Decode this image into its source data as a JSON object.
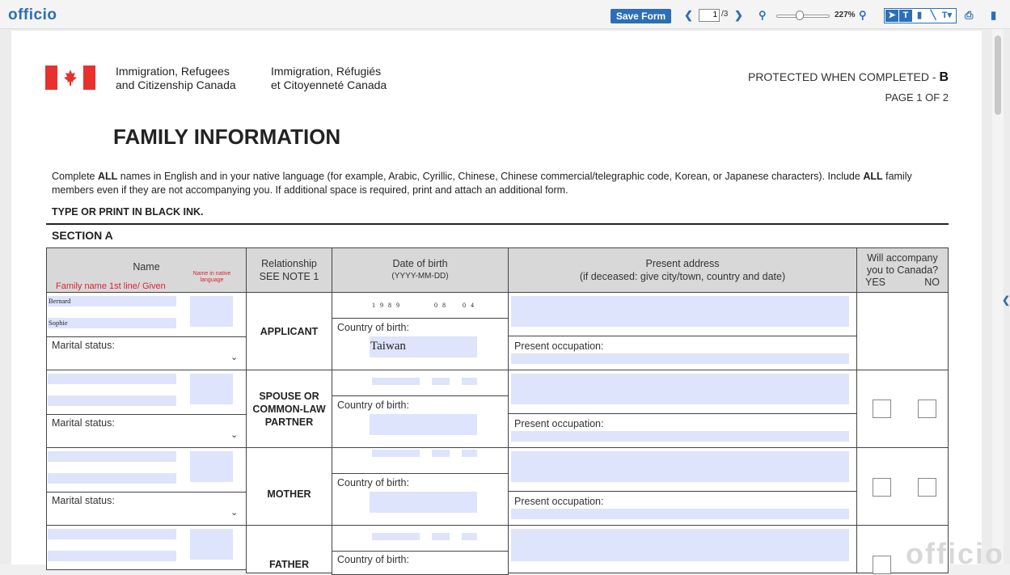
{
  "toolbar": {
    "logo": "officio",
    "save_label": "Save Form",
    "page_current": "1",
    "page_total": "/3",
    "zoom_level": "227%"
  },
  "header": {
    "dept_en_line1": "Immigration, Refugees",
    "dept_en_line2": "and Citizenship Canada",
    "dept_fr_line1": "Immigration, Réfugiés",
    "dept_fr_line2": "et Citoyenneté Canada",
    "protected_label": "PROTECTED WHEN COMPLETED - ",
    "protected_grade": "B",
    "page_count": "PAGE 1 OF 2"
  },
  "form": {
    "title": "FAMILY INFORMATION",
    "intro_part1": "Complete ",
    "intro_bold1": "ALL",
    "intro_part2": " names in English and in your native language (for example, Arabic, Cyrillic, Chinese, Chinese commercial/telegraphic code, Korean, or Japanese characters). Include ",
    "intro_bold2": "ALL",
    "intro_part3": " family members even if they are not accompanying you. If additional space is required, print and attach an additional form.",
    "ink_note": "TYPE OR PRINT IN BLACK INK.",
    "section": "SECTION A"
  },
  "table": {
    "headers": {
      "name": "Name",
      "name_hint_red": "Family name 1st line/ Given",
      "name_native": "Name in native language",
      "relationship": "Relationship",
      "relationship_note": "SEE NOTE 1",
      "dob": "Date of birth",
      "dob_format": "(YYYY-MM-DD)",
      "address": "Present address",
      "address_note": "(if deceased: give city/town, country and date)",
      "accompany": "Will accompany you to Canada?",
      "yes": "YES",
      "no": "NO"
    },
    "labels": {
      "marital": "Marital status:",
      "country_of_birth": "Country of birth:",
      "occupation": "Present occupation:"
    },
    "rows": [
      {
        "relationship": "APPLICANT",
        "family_name": "Bernard",
        "given_name": "Sophie",
        "dob_year": "1989",
        "dob_month": "08",
        "dob_day": "04",
        "country": "Taiwan"
      },
      {
        "relationship": "SPOUSE OR COMMON-LAW PARTNER"
      },
      {
        "relationship": "MOTHER"
      },
      {
        "relationship": "FATHER"
      }
    ]
  },
  "watermark": "officio"
}
